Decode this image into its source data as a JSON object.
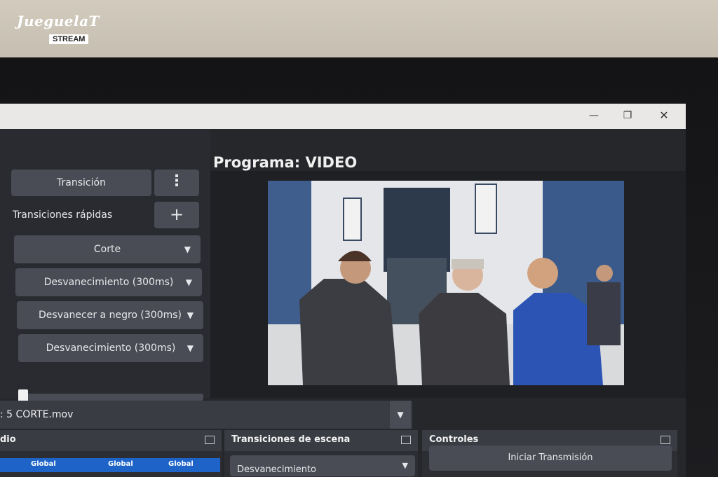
{
  "watermark": {
    "script": "JueguelaT",
    "badge": "STREAM"
  },
  "window": {
    "minimize_icon": "minimize-icon",
    "maximize_icon": "restore-icon",
    "close_icon": "close-icon"
  },
  "transitions": {
    "transition_button": "Transición",
    "quick_label": "Transiciones rápidas",
    "items": [
      "Corte",
      "Desvanecimiento (300ms)",
      "Desvanecer a negro (300ms)",
      "Desvanecimiento (300ms)"
    ]
  },
  "program": {
    "title": "Programa: VIDEO"
  },
  "media": {
    "label": ": 5 CORTE.mov"
  },
  "docks": {
    "audio": {
      "title": "dio",
      "columns": [
        "Global",
        "Global",
        "Global"
      ]
    },
    "scene_transitions": {
      "title": "Transiciones de escena",
      "selected": "Desvanecimiento"
    },
    "controls": {
      "title": "Controles",
      "start_stream": "Iniciar Transmisión"
    }
  }
}
